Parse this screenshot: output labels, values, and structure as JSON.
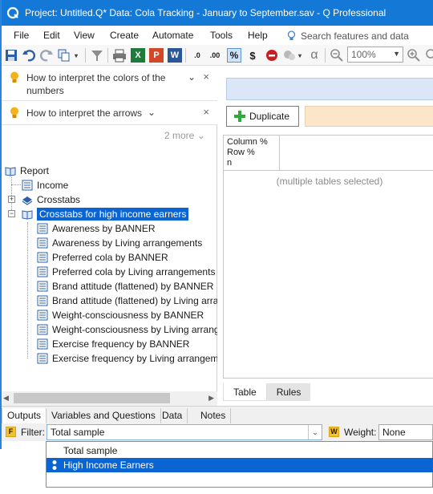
{
  "window": {
    "title": "Project: Untitled.Q*  Data: Cola Tracking - January to September.sav - Q Professional"
  },
  "menu": {
    "items": [
      "File",
      "Edit",
      "View",
      "Create",
      "Automate",
      "Tools",
      "Help"
    ],
    "search_placeholder": "Search features and data"
  },
  "toolbar": {
    "zoom": "100%",
    "buttons": [
      "save-icon",
      "undo-icon",
      "redo-icon",
      "copy-icon",
      "filter-icon",
      "print-icon",
      "excel-icon",
      "powerpoint-icon",
      "word-icon",
      "decrease-decimals-icon",
      "increase-decimals-icon",
      "percent-icon",
      "dollar-icon",
      "stop-icon",
      "statistics-icon",
      "alpha-icon",
      "zoom-out-icon",
      "zoom-in-icon"
    ],
    "decimals_down": ".0",
    "decimals_up": ".00",
    "percent": "%",
    "dollar": "$",
    "alpha": "α",
    "excel_letter": "X",
    "ppt_letter": "P",
    "word_letter": "W"
  },
  "tips": [
    {
      "label": "How to interpret the colors of the numbers"
    },
    {
      "label": "How to interpret the arrows"
    }
  ],
  "more_label": "2 more",
  "tree": {
    "root": "Report",
    "nodes": [
      {
        "label": "Income"
      },
      {
        "label": "Crosstabs"
      },
      {
        "label": "Crosstabs for high income earners"
      },
      {
        "label": "Awareness by BANNER"
      },
      {
        "label": "Awareness by Living arrangements"
      },
      {
        "label": "Preferred cola by BANNER"
      },
      {
        "label": "Preferred cola by Living arrangements"
      },
      {
        "label": "Brand attitude (flattened) by BANNER"
      },
      {
        "label": "Brand attitude (flattened) by Living arra"
      },
      {
        "label": "Weight-consciousness by BANNER"
      },
      {
        "label": "Weight-consciousness by Living arrang"
      },
      {
        "label": "Exercise frequency by BANNER"
      },
      {
        "label": "Exercise frequency by Living arrangeme"
      }
    ]
  },
  "right": {
    "duplicate_label": "Duplicate",
    "stats": [
      "Column %",
      "Row %",
      "n"
    ],
    "multi_msg": "(multiple tables selected)",
    "tabs": [
      "Table",
      "Rules"
    ]
  },
  "bottom_tabs": [
    "Outputs",
    "Variables and Questions",
    "Data",
    "Notes"
  ],
  "filter": {
    "badge": "F",
    "label": "Filter:",
    "value": "Total sample",
    "weight_badge": "W",
    "weight_label": "Weight:",
    "weight_value": "None"
  },
  "dropdown": {
    "options": [
      "Total sample",
      "High Income Earners"
    ]
  },
  "colors": {
    "titlebar": "#1479d6",
    "selection": "#0a64d2",
    "bluebar": "#dbe7f7",
    "tanbar": "#fbe6c9"
  }
}
